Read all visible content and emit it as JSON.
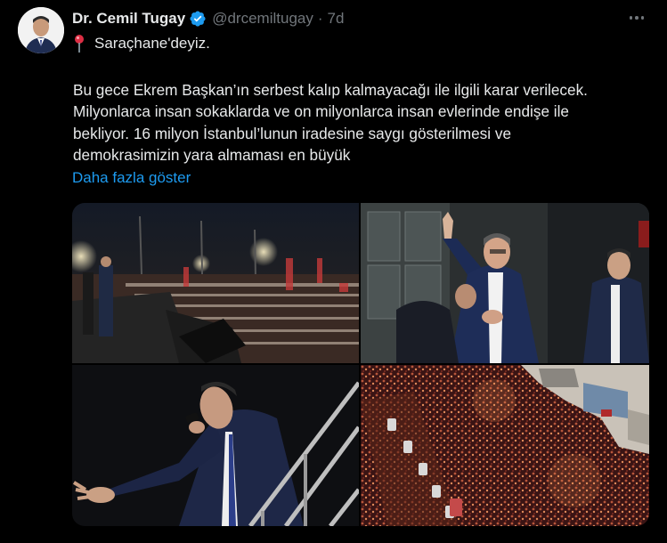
{
  "author": {
    "name": "Dr. Cemil Tugay",
    "handle": "@drcemiltugay",
    "separator": "·",
    "time": "7d"
  },
  "tweet": {
    "pin_icon": "round-pushpin-icon",
    "first_line": "Saraçhane'deyiz.",
    "body_lines": [
      "Bu gece Ekrem Başkan’ın serbest kalıp kalmayacağı ile ilgili karar verilecek.",
      "Milyonlarca insan sokaklarda ve on milyonlarca insan evlerinde endişe ile",
      "bekliyor. 16 milyon İstanbul’lunun iradesine saygı gösterilmesi ve",
      "demokrasimizin yara almaması en büyük"
    ],
    "show_more": "Daha fazla göster"
  },
  "media": {
    "photos": [
      "crowd-at-night-photo",
      "man-waving-on-balcony-photo",
      "speaker-with-microphone-photo",
      "aerial-crowd-photo"
    ]
  },
  "colors": {
    "background": "#000000",
    "text": "#e7e9ea",
    "secondary": "#71767b",
    "link": "#1d9bf0",
    "verified": "#1d9bf0"
  }
}
